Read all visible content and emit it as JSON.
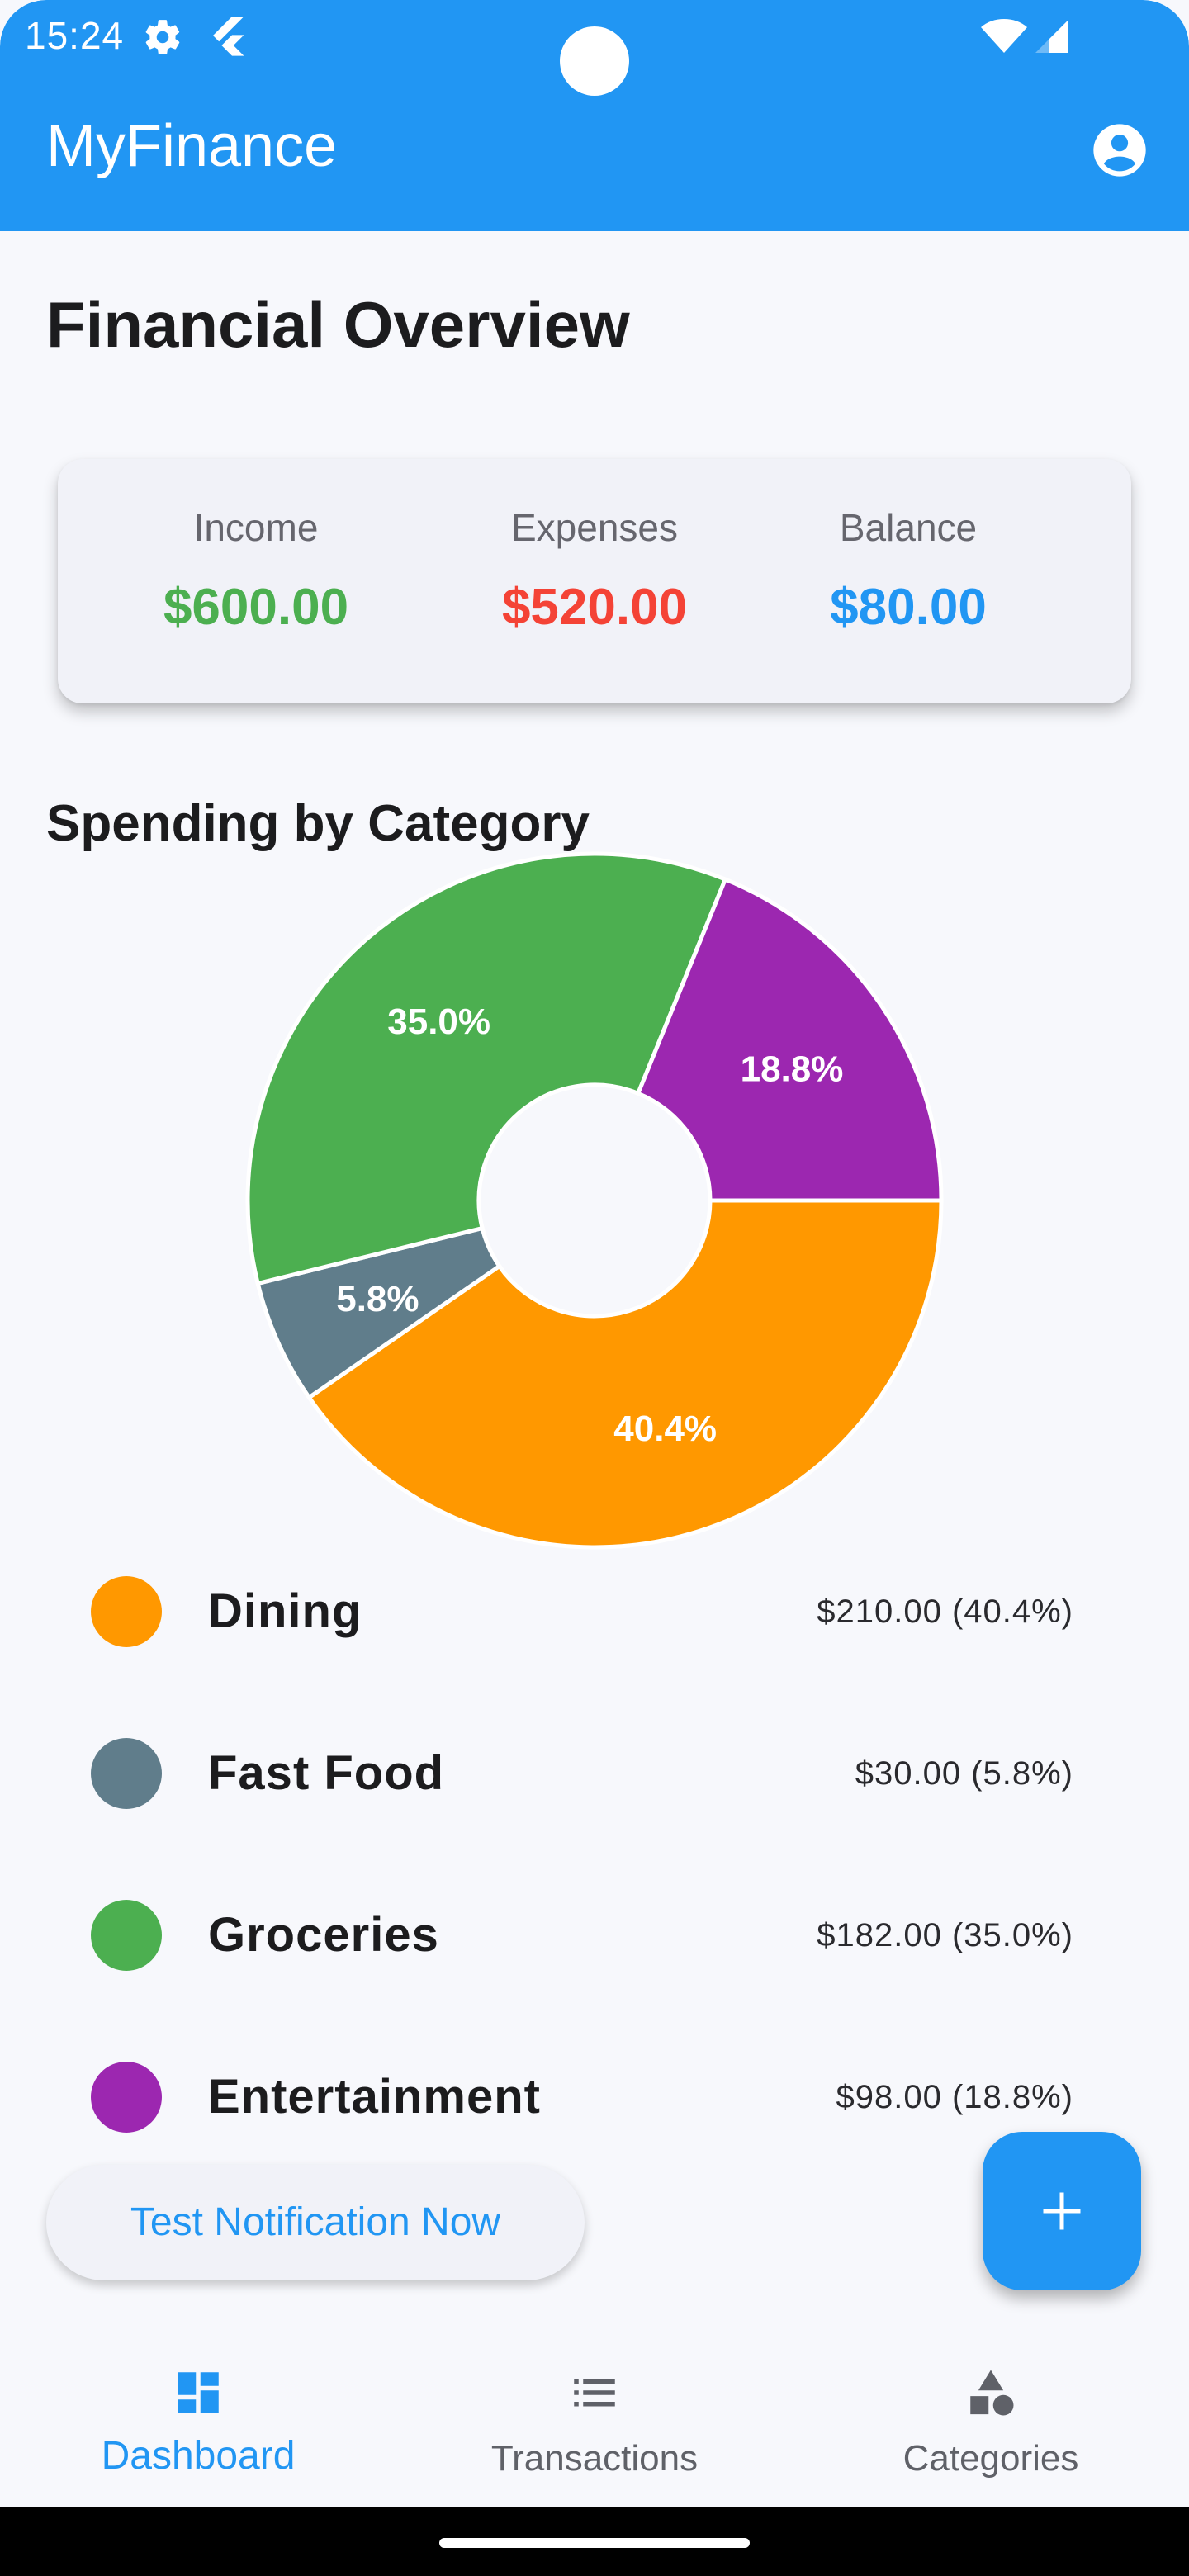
{
  "status_bar": {
    "time": "15:24",
    "icons": [
      "gear-icon",
      "flutter-icon",
      "wifi-icon",
      "signal-icon"
    ]
  },
  "app_bar": {
    "title": "MyFinance",
    "background_color": "#2196F3",
    "profile_icon": "account-circle-icon"
  },
  "page": {
    "title": "Financial Overview"
  },
  "summary": {
    "income_label": "Income",
    "income_value": "$600.00",
    "income_color": "#4CAF50",
    "expenses_label": "Expenses",
    "expenses_value": "$520.00",
    "expenses_color": "#F44336",
    "balance_label": "Balance",
    "balance_value": "$80.00",
    "balance_color": "#2196F3"
  },
  "chart_section": {
    "title": "Spending by Category"
  },
  "chart_data": {
    "type": "pie",
    "donut": true,
    "categories": [
      "Dining",
      "Fast Food",
      "Groceries",
      "Entertainment"
    ],
    "values": [
      210,
      30,
      182,
      98
    ],
    "percent_labels": [
      "40.4%",
      "5.8%",
      "35.0%",
      "18.8%"
    ],
    "colors": [
      "#FF9800",
      "#607D8B",
      "#4CAF50",
      "#9C27B0"
    ]
  },
  "legend": [
    {
      "name": "Dining",
      "value": "$210.00 (40.4%)",
      "color": "#FF9800"
    },
    {
      "name": "Fast Food",
      "value": "$30.00 (5.8%)",
      "color": "#607D8B"
    },
    {
      "name": "Groceries",
      "value": "$182.00 (35.0%)",
      "color": "#4CAF50"
    },
    {
      "name": "Entertainment",
      "value": "$98.00 (18.8%)",
      "color": "#9C27B0"
    }
  ],
  "test_button": {
    "label": "Test Notification Now"
  },
  "fab": {
    "icon": "plus-icon"
  },
  "bottom_nav": {
    "items": [
      {
        "label": "Dashboard",
        "icon": "dashboard-icon",
        "active": true
      },
      {
        "label": "Transactions",
        "icon": "list-icon",
        "active": false
      },
      {
        "label": "Categories",
        "icon": "category-shapes-icon",
        "active": false
      }
    ],
    "active_color": "#2196F3"
  }
}
